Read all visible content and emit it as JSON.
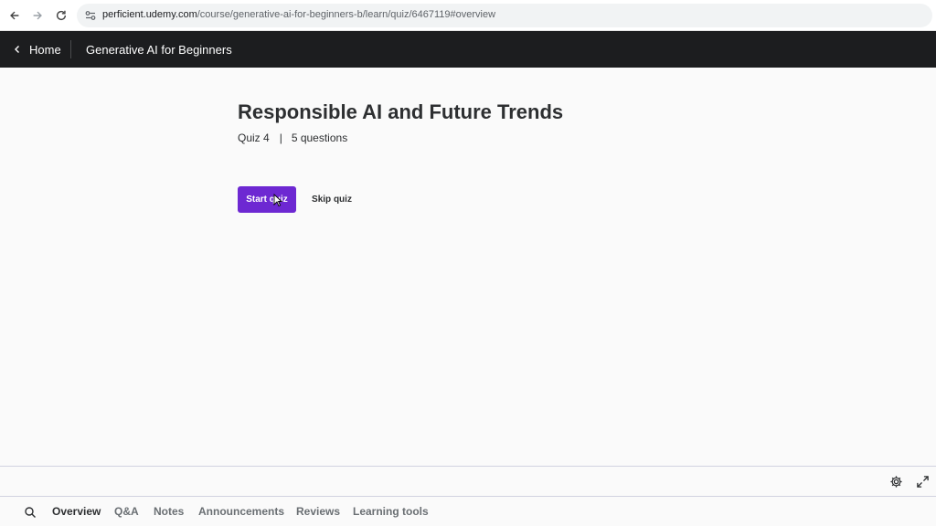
{
  "browser": {
    "url_domain": "perficient.udemy.com",
    "url_path": "/course/generative-ai-for-beginners-b/learn/quiz/6467119#overview"
  },
  "header": {
    "home_label": "Home",
    "course_title": "Generative AI for Beginners"
  },
  "quiz": {
    "title": "Responsible AI and Future Trends",
    "number_label": "Quiz 4",
    "separator": "|",
    "questions_label": "5 questions",
    "start_label": "Start quiz",
    "skip_label": "Skip quiz"
  },
  "tabs": {
    "items": [
      "Overview",
      "Q&A",
      "Notes",
      "Announcements",
      "Reviews",
      "Learning tools"
    ],
    "active": "Overview"
  },
  "colors": {
    "accent": "#6d28d2",
    "header_bg": "#1c1d1f"
  },
  "icons": [
    "back-arrow-icon",
    "forward-arrow-icon",
    "reload-icon",
    "site-settings-icon",
    "chevron-left-icon",
    "settings-gear-icon",
    "fullscreen-icon",
    "search-icon"
  ]
}
